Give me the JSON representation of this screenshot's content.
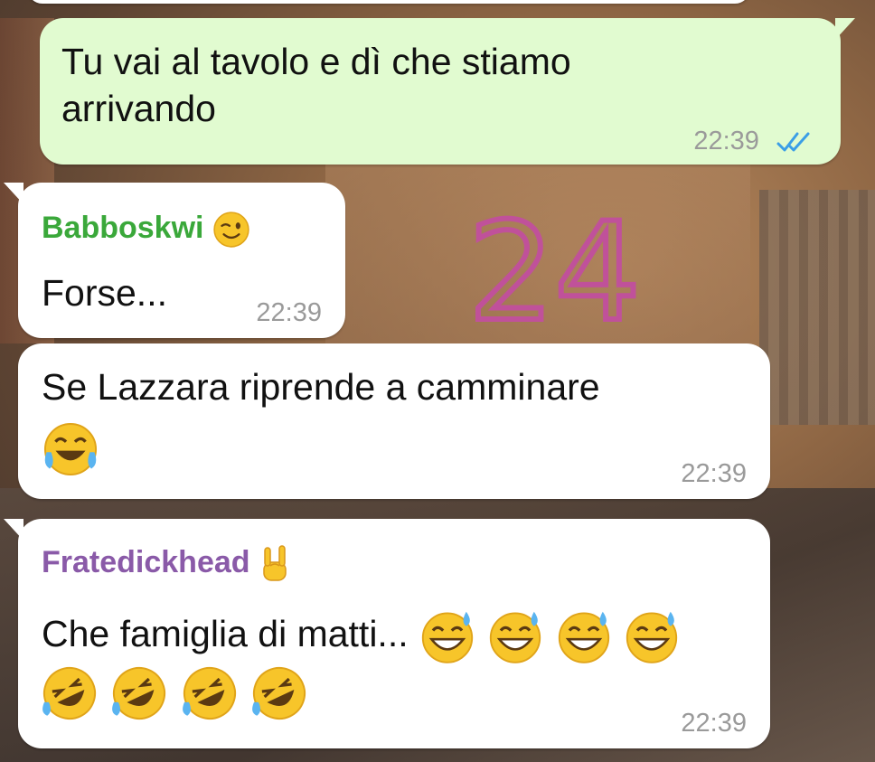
{
  "sticker_text": "24",
  "colors": {
    "outgoing_bubble": "#e1fbd0",
    "incoming_bubble": "#ffffff",
    "sender1": "#3aa83a",
    "sender2": "#8a5aa8",
    "read_ticks": "#3b9ee6",
    "handwriting": "#c0519a"
  },
  "messages": [
    {
      "direction": "outgoing",
      "lines": [
        "Tu vai al tavolo e dì che stiamo",
        "arrivando"
      ],
      "time": "22:39",
      "status_icon": "double-check-read-icon"
    },
    {
      "direction": "incoming",
      "sender": "Babboskwi",
      "sender_emoji": "winking-face-icon",
      "text": "Forse...",
      "time": "22:39"
    },
    {
      "direction": "incoming",
      "text": "Se Lazzara riprende a camminare",
      "emojis": [
        "face-with-tears-of-joy-icon"
      ],
      "time": "22:39"
    },
    {
      "direction": "incoming",
      "sender": "Fratedickhead",
      "sender_emoji": "sign-of-horns-icon",
      "text": "Che famiglia di matti...",
      "emojis_line1": [
        "grinning-face-with-sweat-icon",
        "grinning-face-with-sweat-icon",
        "grinning-face-with-sweat-icon",
        "grinning-face-with-sweat-icon"
      ],
      "emojis_line2": [
        "rolling-on-floor-laughing-icon",
        "rolling-on-floor-laughing-icon",
        "rolling-on-floor-laughing-icon",
        "rolling-on-floor-laughing-icon"
      ],
      "time": "22:39"
    }
  ]
}
